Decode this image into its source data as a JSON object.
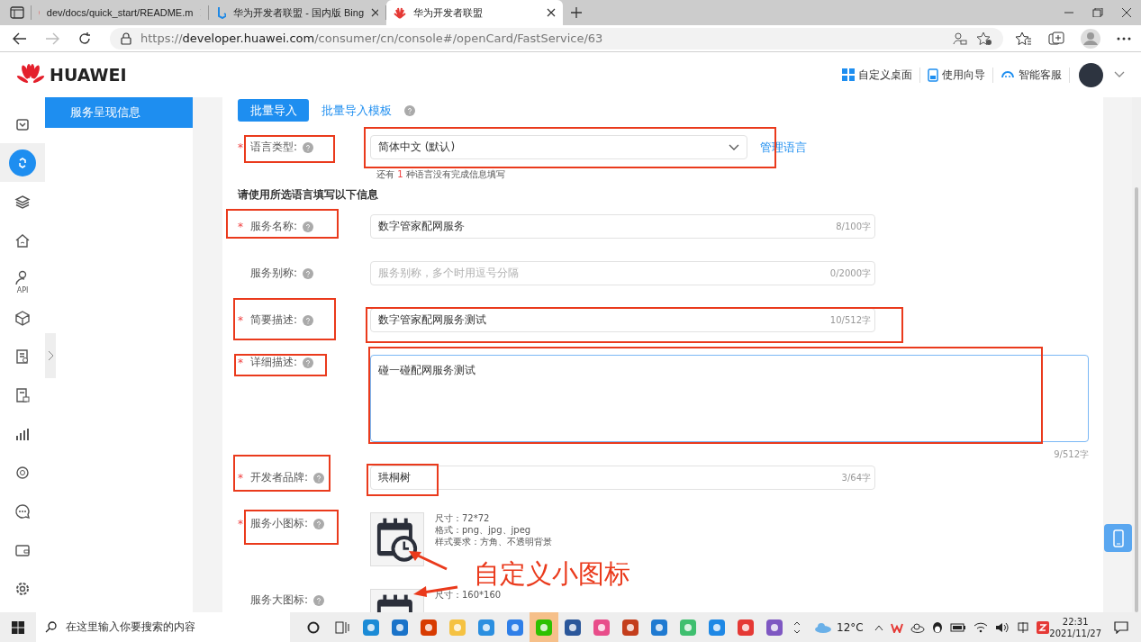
{
  "browser": {
    "tabs": [
      {
        "title": "dev/docs/quick_start/README.m",
        "selected": false
      },
      {
        "title": "华为开发者联盟 - 国内版 Bing",
        "selected": false
      },
      {
        "title": "华为开发者联盟",
        "selected": true
      }
    ],
    "url": {
      "scheme": "https://",
      "host": "developer.huawei.com",
      "path": "/consumer/cn/console#/openCard/FastService/63"
    }
  },
  "header": {
    "logo": "HUAWEI",
    "links": [
      "自定义桌面",
      "使用向导",
      "智能客服"
    ]
  },
  "rail": [
    {
      "selected": false
    },
    {
      "selected": true
    },
    {
      "selected": false
    },
    {
      "selected": false
    },
    {
      "selected": false,
      "label": "API"
    },
    {
      "selected": false
    },
    {
      "selected": false
    },
    {
      "selected": false
    },
    {
      "selected": false
    },
    {
      "selected": false
    },
    {
      "selected": false
    },
    {
      "selected": false
    },
    {
      "selected": false
    }
  ],
  "sidebar": {
    "items": [
      {
        "label": "服务呈现信息",
        "selected": true
      }
    ]
  },
  "toolbar": {
    "import_button": "批量导入",
    "template_link": "批量导入模板"
  },
  "form": {
    "required_mark": "*",
    "language": {
      "label": "语言类型:",
      "required": true,
      "value": "简体中文 (默认)",
      "link": "管理语言",
      "hint": {
        "before": "还有 ",
        "count": "1",
        "after": " 种语言没有完成信息填写"
      }
    },
    "section_title": "请使用所选语言填写以下信息",
    "fields": [
      {
        "kind": "text",
        "label": "服务名称:",
        "required": true,
        "value": "数字管家配网服务",
        "counter": "8/100字"
      },
      {
        "kind": "text",
        "label": "服务别称:",
        "required": false,
        "placeholder": "服务别称，多个时用逗号分隔",
        "counter": "0/2000字"
      },
      {
        "kind": "text",
        "label": "简要描述:",
        "required": true,
        "value": "数字管家配网服务测试",
        "counter": "10/512字"
      },
      {
        "kind": "textarea",
        "label": "详细描述:",
        "required": true,
        "value": "碰一碰配网服务测试",
        "counter": "9/512字"
      },
      {
        "kind": "text",
        "label": "开发者品牌:",
        "required": true,
        "value": "珙桐树",
        "counter": "3/64字"
      },
      {
        "kind": "image",
        "label": "服务小图标:",
        "required": true,
        "specs": [
          "尺寸：72*72",
          "格式：png、jpg、jpeg",
          "样式要求：方角、不透明背景"
        ]
      },
      {
        "kind": "image",
        "label": "服务大图标:",
        "required": false,
        "specs": [
          "尺寸：160*160"
        ]
      }
    ]
  },
  "annotation": {
    "text": "自定义小图标"
  },
  "taskbar": {
    "search_placeholder": "在这里输入你要搜索的内容",
    "temperature": "12°C",
    "time": "22:31",
    "date": "2021/11/27"
  }
}
